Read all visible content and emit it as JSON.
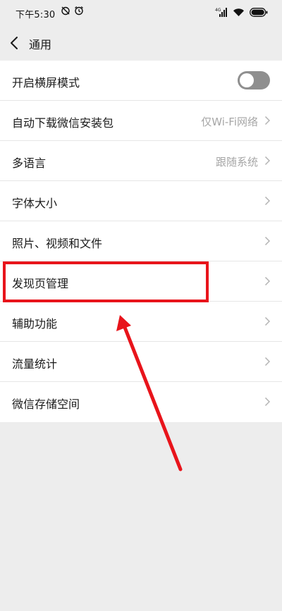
{
  "status_bar": {
    "time": "下午5:30",
    "network": "4G"
  },
  "nav": {
    "title": "通用"
  },
  "settings": [
    {
      "label": "开启横屏模式",
      "type": "toggle",
      "enabled": false
    },
    {
      "label": "自动下载微信安装包",
      "value": "仅Wi-Fi网络"
    },
    {
      "label": "多语言",
      "value": "跟随系统"
    },
    {
      "label": "字体大小",
      "value": ""
    },
    {
      "label": "照片、视频和文件",
      "value": ""
    },
    {
      "label": "发现页管理",
      "value": "",
      "highlighted": true
    },
    {
      "label": "辅助功能",
      "value": ""
    },
    {
      "label": "流量统计",
      "value": ""
    },
    {
      "label": "微信存储空间",
      "value": ""
    }
  ],
  "colors": {
    "background": "#ededed",
    "list_background": "#ffffff",
    "annotation": "#e8141b",
    "toggle_off": "#8f8f8f",
    "secondary_text": "#a6a6a6"
  },
  "icons": [
    "alarm-off-icon",
    "alarm-clock-icon",
    "cellular-signal-icon",
    "wifi-icon",
    "battery-icon",
    "back-chevron-icon",
    "chevron-right-icon"
  ]
}
